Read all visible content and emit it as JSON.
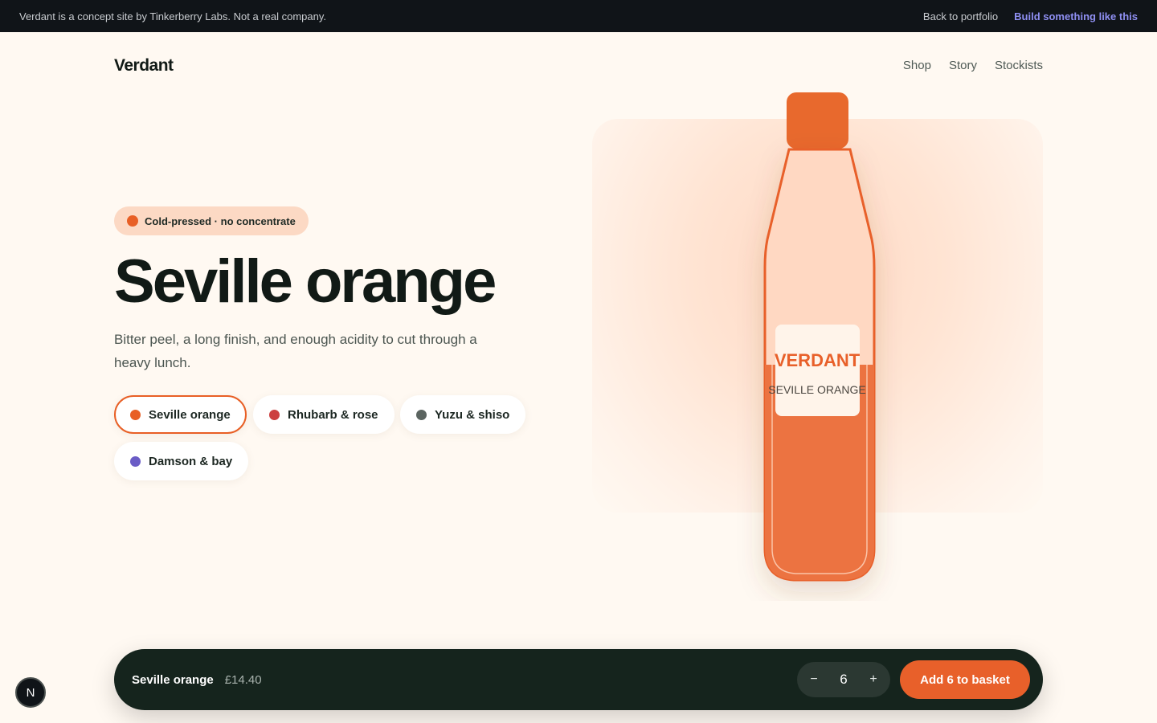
{
  "banner": {
    "notice": "Verdant is a concept site by Tinkerberry Labs. Not a real company.",
    "back_link": "Back to portfolio",
    "cta_link": "Build something like this"
  },
  "header": {
    "brand": "Verdant",
    "nav": [
      "Shop",
      "Story",
      "Stockists"
    ]
  },
  "hero": {
    "pill_label": "Cold-pressed · no concentrate",
    "title": "Seville orange",
    "description": "Bitter peel, a long finish, and enough acidity to cut through a heavy lunch."
  },
  "flavours": [
    {
      "label": "Seville orange",
      "color": "#e85f25",
      "selected": true
    },
    {
      "label": "Rhubarb & rose",
      "color": "#cc3f3f",
      "selected": false
    },
    {
      "label": "Yuzu & shiso",
      "color": "#5b6460",
      "selected": false
    },
    {
      "label": "Damson & bay",
      "color": "#6a5cc6",
      "selected": false
    }
  ],
  "bottle": {
    "brand_label": "VERDANT",
    "flavour_label": "SEVILLE ORANGE",
    "fill_level": 0.5,
    "accent": "#e8602a"
  },
  "basket": {
    "product": "Seville orange",
    "price": "£14.40",
    "decrement": "−",
    "quantity": "6",
    "increment": "+",
    "add_label": "Add 6 to basket"
  },
  "floating_badge": "N",
  "colors": {
    "accent": "#e8602a",
    "dark": "#15241d",
    "background": "#fff9f2"
  }
}
